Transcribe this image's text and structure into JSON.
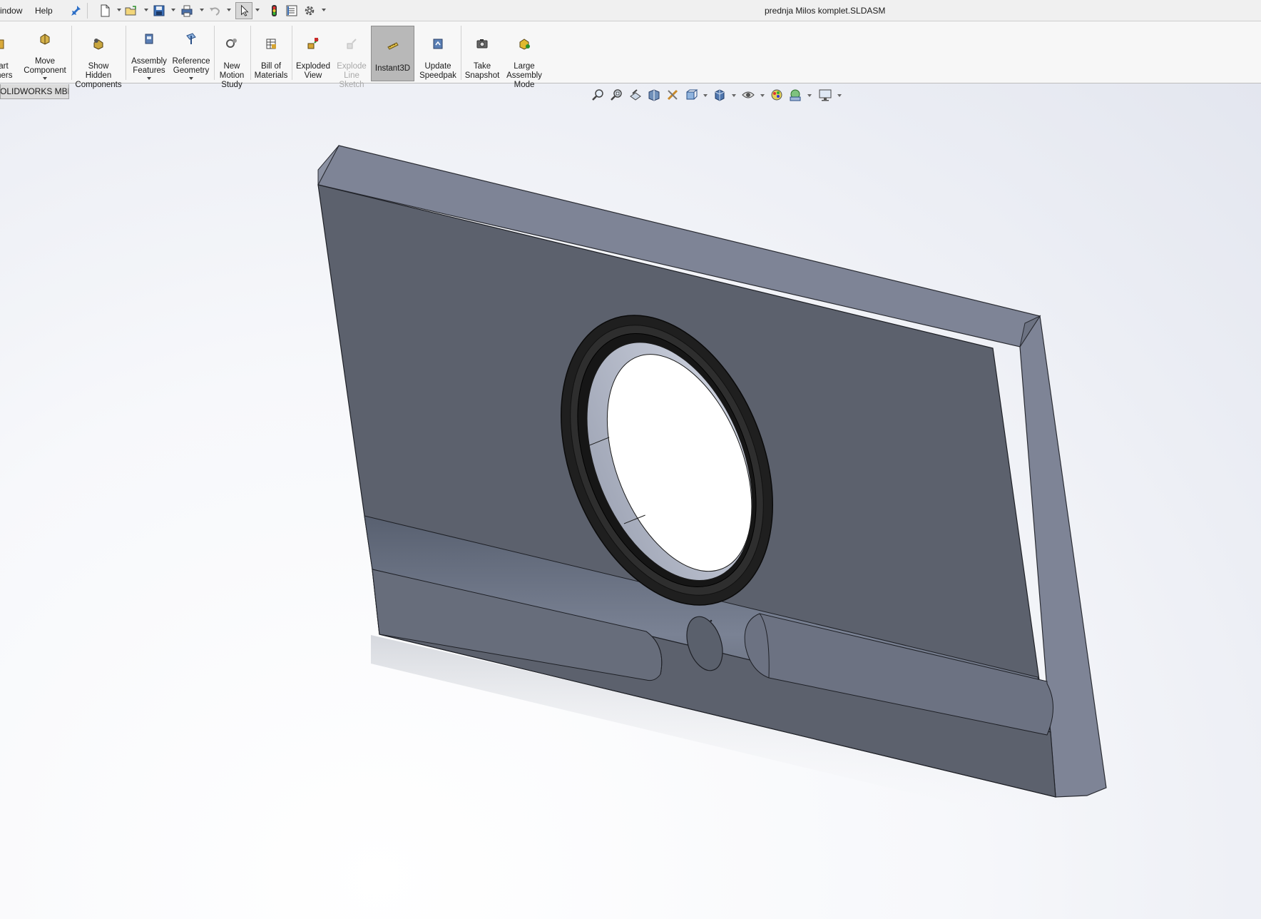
{
  "menu": {
    "window_label": "indow",
    "help_label": "Help"
  },
  "document_title": "prednja Milos komplet.SLDASM",
  "ribbon": {
    "items": [
      {
        "label": "art\niners"
      },
      {
        "label": "Move\nComponent"
      },
      {
        "label": "Show\nHidden\nComponents"
      },
      {
        "label": "Assembly\nFeatures"
      },
      {
        "label": "Reference\nGeometry"
      },
      {
        "label": "New\nMotion\nStudy"
      },
      {
        "label": "Bill of\nMaterials"
      },
      {
        "label": "Exploded\nView"
      },
      {
        "label": "Explode\nLine\nSketch"
      },
      {
        "label": "Instant3D"
      },
      {
        "label": "Update\nSpeedpak"
      },
      {
        "label": "Take\nSnapshot"
      },
      {
        "label": "Large\nAssembly\nMode"
      }
    ]
  },
  "tabs": {
    "mbd_label": "OLIDWORKS MBD"
  },
  "colors": {
    "part_face": "#5c616d",
    "part_edge": "#7e8496",
    "ring": "#1f1f1f",
    "active_button": "#b8b8b8"
  },
  "icons": [
    "pin-icon",
    "new-document-icon",
    "open-icon",
    "save-icon",
    "print-icon",
    "undo-icon",
    "select-icon",
    "rebuild-icon",
    "file-properties-icon",
    "options-icon",
    "zoom-to-fit-icon",
    "zoom-to-area-icon",
    "previous-view-icon",
    "section-view-icon",
    "dynamic-annotation-icon",
    "view-orientation-icon",
    "display-style-icon",
    "hide-show-items-icon",
    "edit-appearance-icon",
    "apply-scene-icon",
    "view-settings-icon"
  ]
}
